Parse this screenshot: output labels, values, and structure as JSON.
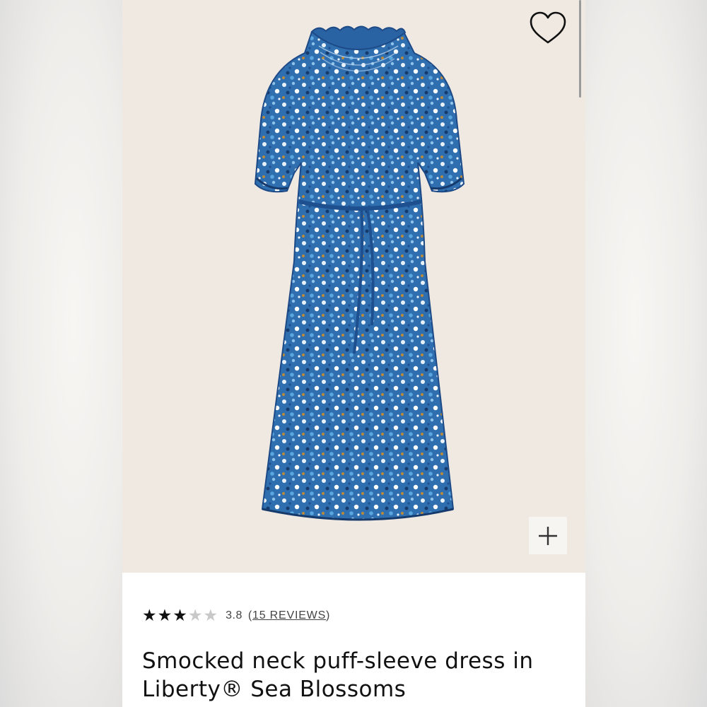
{
  "product": {
    "title": "Smocked neck puff-sleeve dress in Liberty® Sea Blossoms",
    "image_alt": "Blue floral midi dress with smocked neck, puff sleeves and tie belt"
  },
  "rating": {
    "value": "3.8",
    "stars": 3.8,
    "max_stars": 5,
    "reviews_prefix": "(",
    "reviews_label": "15 REVIEWS",
    "reviews_suffix": ")"
  },
  "actions": {
    "favorite_icon": "heart-outline-icon",
    "zoom_icon": "plus-icon"
  },
  "colors": {
    "hero_background": "#efe9e2",
    "dress_primary": "#2f6fb0",
    "dress_dark": "#163a6b",
    "text": "#111111"
  }
}
